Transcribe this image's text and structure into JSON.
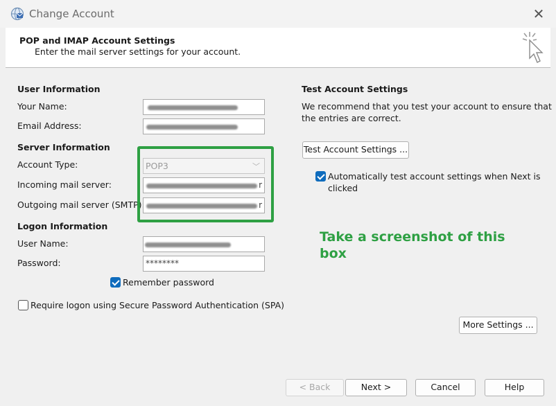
{
  "window": {
    "title": "Change Account"
  },
  "header": {
    "title": "POP and IMAP Account Settings",
    "subtitle": "Enter the mail server settings for your account."
  },
  "user_info": {
    "heading": "User Information",
    "name_label": "Your Name:",
    "email_label": "Email Address:"
  },
  "server_info": {
    "heading": "Server Information",
    "account_type_label": "Account Type:",
    "account_type_value": "POP3",
    "incoming_label": "Incoming mail server:",
    "incoming_tail": "r",
    "outgoing_label": "Outgoing mail server (SMTP):",
    "outgoing_tail": "r"
  },
  "logon_info": {
    "heading": "Logon Information",
    "username_label": "User Name:",
    "password_label": "Password:",
    "password_value": "********",
    "remember_label": "Remember password",
    "remember_checked": true,
    "spa_label": "Require logon using Secure Password Authentication (SPA)",
    "spa_checked": false
  },
  "test_settings": {
    "heading": "Test Account Settings",
    "description_line1": "We recommend that you test your account to ensure that",
    "description_line2": "the entries are correct.",
    "button_label": "Test Account Settings ...",
    "auto_test_line1": "Automatically test account settings when Next is",
    "auto_test_line2": "clicked",
    "auto_test_checked": true
  },
  "annotation": {
    "text_line1": "Take a screenshot of this",
    "text_line2": "box",
    "color": "#2ea043"
  },
  "buttons": {
    "more_settings": "More Settings ...",
    "back": "< Back",
    "next": "Next >",
    "cancel": "Cancel",
    "help": "Help"
  },
  "colors": {
    "accent": "#0f6cbd",
    "highlight": "#2ea043"
  }
}
